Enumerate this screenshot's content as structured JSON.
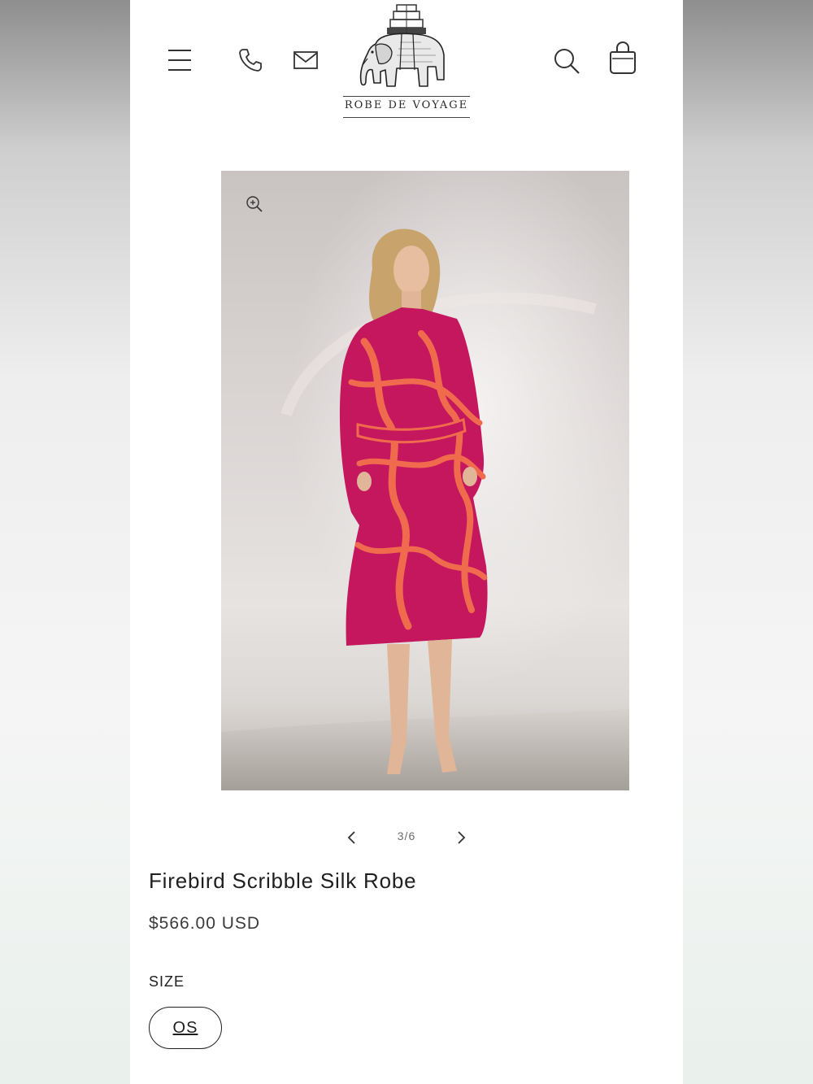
{
  "header": {
    "brand_name": "ROBE DE VOYAGE",
    "icons": [
      "hamburger-menu-icon",
      "phone-icon",
      "mail-icon",
      "search-icon",
      "shopping-bag-icon"
    ]
  },
  "gallery": {
    "current_page": "3/6",
    "image_alt": "Model wearing Firebird Scribble Silk Robe"
  },
  "product": {
    "title": "Firebird Scribble Silk Robe",
    "price": "$566.00 USD",
    "size_label": "SIZE",
    "size_options": [
      "OS"
    ],
    "selected_size": "OS"
  },
  "colors": {
    "text": "#1f1f1f",
    "robe_magenta": "#c4175e",
    "robe_pattern": "#f06a4d",
    "page_bg": "#ffffff"
  }
}
